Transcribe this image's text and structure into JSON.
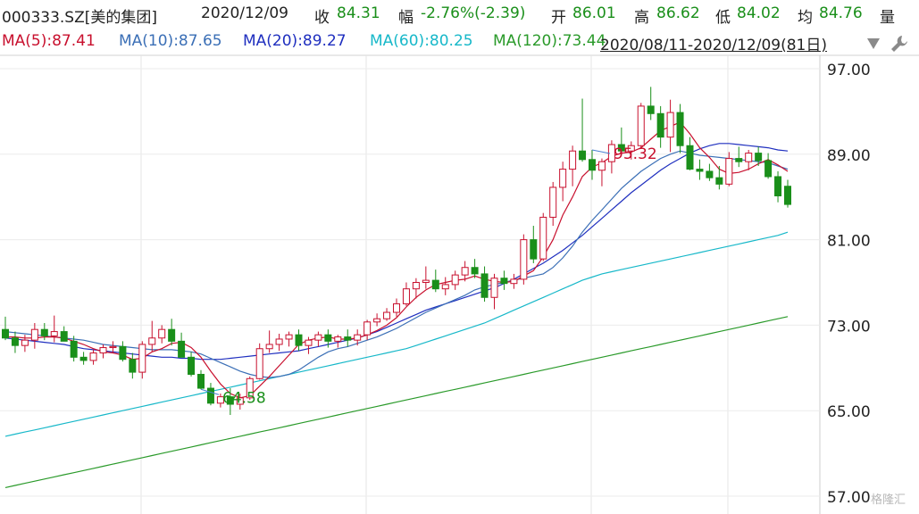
{
  "header": {
    "code": "000333.SZ[美的集团]",
    "date": "2020/12/09",
    "close_label": "收",
    "close_value": "84.31",
    "change_label": "幅",
    "change_value": "-2.76%(-2.39)",
    "open_label": "开",
    "open_value": "86.01",
    "high_label": "高",
    "high_value": "86.62",
    "low_label": "低",
    "low_value": "84.02",
    "avg_label": "均",
    "avg_value": "84.76",
    "volume_label": "量"
  },
  "ma_legend": [
    {
      "text": "MA(5):87.41",
      "color": "#c8102e"
    },
    {
      "text": "MA(10):87.65",
      "color": "#3b6fb6"
    },
    {
      "text": "MA(20):89.27",
      "color": "#1f2fbf"
    },
    {
      "text": "MA(60):80.25",
      "color": "#17b8c9"
    },
    {
      "text": "MA(120):73.44",
      "color": "#2a9a2a"
    }
  ],
  "range_text": "2020/08/11-2020/12/09(81日)",
  "watermark": "格隆汇",
  "chart_data": {
    "type": "candlestick",
    "ylim": [
      57,
      97
    ],
    "yticks": [
      "97.00",
      "89.00",
      "81.00",
      "73.00",
      "65.00",
      "57.00"
    ],
    "up_color": "#c8102e",
    "down_color": "#1a8f1a",
    "annotations": [
      {
        "text": "95.32",
        "color": "#c8102e",
        "index": 60
      },
      {
        "text": "64.58",
        "color": "#1a8f1a",
        "index": 20
      }
    ],
    "candles": [
      [
        72.6,
        73.8,
        71.6,
        71.8
      ],
      [
        71.8,
        72.4,
        70.4,
        71.1
      ],
      [
        71.1,
        72.1,
        70.5,
        71.6
      ],
      [
        71.6,
        73.2,
        70.8,
        72.6
      ],
      [
        72.6,
        73.2,
        71.6,
        72.0
      ],
      [
        72.0,
        73.9,
        71.4,
        72.4
      ],
      [
        72.4,
        72.9,
        71.7,
        71.5
      ],
      [
        71.5,
        72.0,
        69.6,
        70.0
      ],
      [
        70.0,
        70.5,
        69.3,
        69.7
      ],
      [
        69.7,
        70.7,
        69.3,
        70.4
      ],
      [
        70.4,
        71.2,
        69.9,
        70.9
      ],
      [
        70.9,
        71.5,
        70.4,
        71.0
      ],
      [
        71.0,
        71.5,
        69.6,
        69.8
      ],
      [
        69.8,
        70.4,
        68.0,
        68.6
      ],
      [
        68.6,
        71.5,
        68.0,
        71.2
      ],
      [
        71.2,
        73.4,
        70.5,
        71.8
      ],
      [
        71.8,
        73.0,
        71.3,
        72.6
      ],
      [
        72.6,
        73.6,
        71.1,
        71.5
      ],
      [
        71.5,
        72.3,
        70.3,
        70.0
      ],
      [
        70.0,
        70.5,
        68.2,
        68.4
      ],
      [
        68.4,
        68.8,
        67.0,
        67.1
      ],
      [
        67.1,
        67.6,
        65.5,
        65.7
      ],
      [
        65.7,
        66.6,
        65.3,
        66.3
      ],
      [
        66.3,
        67.1,
        64.6,
        65.6
      ],
      [
        65.6,
        66.6,
        65.1,
        66.2
      ],
      [
        66.2,
        68.2,
        66.0,
        68.0
      ],
      [
        68.0,
        71.3,
        67.9,
        70.8
      ],
      [
        70.8,
        72.5,
        70.4,
        71.2
      ],
      [
        71.2,
        72.2,
        70.6,
        71.7
      ],
      [
        71.7,
        72.4,
        71.0,
        72.1
      ],
      [
        72.1,
        72.6,
        70.6,
        71.1
      ],
      [
        71.1,
        71.9,
        70.3,
        71.6
      ],
      [
        71.6,
        72.4,
        71.0,
        72.1
      ],
      [
        72.1,
        72.6,
        70.9,
        71.5
      ],
      [
        71.5,
        72.1,
        70.9,
        71.9
      ],
      [
        71.9,
        72.6,
        71.0,
        71.6
      ],
      [
        71.6,
        72.6,
        71.1,
        72.1
      ],
      [
        72.1,
        73.5,
        71.6,
        73.3
      ],
      [
        73.3,
        74.1,
        72.9,
        73.6
      ],
      [
        73.6,
        74.6,
        73.4,
        74.2
      ],
      [
        74.2,
        75.5,
        73.8,
        75.0
      ],
      [
        75.0,
        77.0,
        74.8,
        76.4
      ],
      [
        76.4,
        77.4,
        75.5,
        77.0
      ],
      [
        77.0,
        78.5,
        76.4,
        77.2
      ],
      [
        77.2,
        78.2,
        76.1,
        76.4
      ],
      [
        76.4,
        77.5,
        75.8,
        76.8
      ],
      [
        76.8,
        78.1,
        76.3,
        77.7
      ],
      [
        77.7,
        79.0,
        77.1,
        78.4
      ],
      [
        78.4,
        79.2,
        77.4,
        77.8
      ],
      [
        77.8,
        78.5,
        75.2,
        75.6
      ],
      [
        75.6,
        77.8,
        74.5,
        77.4
      ],
      [
        77.4,
        78.1,
        76.3,
        76.9
      ],
      [
        76.9,
        77.8,
        76.4,
        77.3
      ],
      [
        77.3,
        81.5,
        76.8,
        81.0
      ],
      [
        81.0,
        82.3,
        78.8,
        79.2
      ],
      [
        79.2,
        83.5,
        79.0,
        83.1
      ],
      [
        83.1,
        86.4,
        82.3,
        85.9
      ],
      [
        85.9,
        88.3,
        84.6,
        87.6
      ],
      [
        87.6,
        89.8,
        86.0,
        89.3
      ],
      [
        89.3,
        94.2,
        88.3,
        88.5
      ],
      [
        88.5,
        89.4,
        86.6,
        87.5
      ],
      [
        87.5,
        88.6,
        86.0,
        88.3
      ],
      [
        88.3,
        90.3,
        87.2,
        89.9
      ],
      [
        89.9,
        91.5,
        89.0,
        89.3
      ],
      [
        89.3,
        90.2,
        88.5,
        89.8
      ],
      [
        89.8,
        93.8,
        89.5,
        93.5
      ],
      [
        93.5,
        95.3,
        92.2,
        92.8
      ],
      [
        92.8,
        93.5,
        89.6,
        90.6
      ],
      [
        90.6,
        94.1,
        89.2,
        92.9
      ],
      [
        92.9,
        93.7,
        89.1,
        89.8
      ],
      [
        89.8,
        90.6,
        87.5,
        87.6
      ],
      [
        87.6,
        88.5,
        86.6,
        87.4
      ],
      [
        87.4,
        88.1,
        86.5,
        86.8
      ],
      [
        86.8,
        87.9,
        85.7,
        86.2
      ],
      [
        86.2,
        89.2,
        86.0,
        88.6
      ],
      [
        88.6,
        89.7,
        87.8,
        88.3
      ],
      [
        88.3,
        89.4,
        87.5,
        89.1
      ],
      [
        89.1,
        89.7,
        87.9,
        88.4
      ],
      [
        88.4,
        89.1,
        86.7,
        86.9
      ],
      [
        86.9,
        87.4,
        84.5,
        85.1
      ],
      [
        86.0,
        86.6,
        84.0,
        84.3
      ]
    ],
    "ma5": [
      71.9,
      71.9,
      71.8,
      71.8,
      71.9,
      71.9,
      71.8,
      71.5,
      71.2,
      70.8,
      70.5,
      70.4,
      70.2,
      69.8,
      69.9,
      70.5,
      70.8,
      71.3,
      71.4,
      70.9,
      70.0,
      68.7,
      67.5,
      66.6,
      66.2,
      66.4,
      67.3,
      68.2,
      69.2,
      70.2,
      71.2,
      71.6,
      71.8,
      71.9,
      71.7,
      71.7,
      71.8,
      72.1,
      72.5,
      73.0,
      73.7,
      74.7,
      75.6,
      76.3,
      76.8,
      77.0,
      77.2,
      77.3,
      77.6,
      77.3,
      77.1,
      77.0,
      77.1,
      77.6,
      78.1,
      79.4,
      81.0,
      83.3,
      85.0,
      86.9,
      87.8,
      88.2,
      88.8,
      89.1,
      89.2,
      89.6,
      90.4,
      91.2,
      91.6,
      92.0,
      90.9,
      89.6,
      88.7,
      87.6,
      87.2,
      87.3,
      87.6,
      88.1,
      88.5,
      88.0,
      87.4
    ],
    "ma10": [
      72.4,
      72.3,
      72.2,
      72.1,
      72.0,
      71.9,
      71.8,
      71.7,
      71.6,
      71.4,
      71.2,
      71.1,
      71.0,
      70.9,
      70.8,
      70.7,
      70.7,
      70.7,
      70.6,
      70.5,
      70.3,
      69.9,
      69.5,
      69.1,
      68.7,
      68.4,
      68.2,
      68.1,
      68.2,
      68.4,
      68.8,
      69.4,
      70.0,
      70.5,
      70.8,
      71.0,
      71.3,
      71.6,
      71.9,
      72.3,
      72.7,
      73.2,
      73.7,
      74.2,
      74.6,
      75.0,
      75.4,
      75.8,
      76.3,
      76.6,
      76.8,
      77.0,
      77.2,
      77.4,
      77.6,
      77.8,
      78.4,
      79.3,
      80.4,
      81.7,
      82.8,
      83.8,
      84.8,
      85.8,
      86.6,
      87.4,
      88.0,
      88.6,
      89.0,
      89.3,
      89.1,
      88.9,
      88.8,
      88.7,
      88.6,
      88.5,
      88.4,
      88.3,
      88.2,
      87.9,
      87.6
    ],
    "ma20": [
      71.8,
      71.7,
      71.6,
      71.5,
      71.4,
      71.3,
      71.2,
      71.0,
      70.8,
      70.7,
      70.6,
      70.5,
      70.4,
      70.3,
      70.2,
      70.1,
      70.0,
      70.0,
      69.9,
      69.9,
      69.8,
      69.8,
      69.8,
      69.9,
      70.0,
      70.1,
      70.2,
      70.3,
      70.4,
      70.5,
      70.6,
      70.8,
      71.0,
      71.2,
      71.4,
      71.6,
      71.8,
      72.1,
      72.4,
      72.8,
      73.2,
      73.6,
      74.0,
      74.4,
      74.7,
      75.0,
      75.3,
      75.6,
      75.9,
      76.2,
      76.5,
      76.9,
      77.3,
      77.8,
      78.3,
      78.8,
      79.4,
      80.0,
      80.7,
      81.4,
      82.2,
      83.0,
      83.8,
      84.6,
      85.4,
      86.1,
      86.8,
      87.5,
      88.1,
      88.6,
      89.1,
      89.5,
      89.8,
      90.0,
      90.0,
      89.9,
      89.8,
      89.7,
      89.6,
      89.4,
      89.3
    ],
    "ma60": [
      62.6,
      62.8,
      63.0,
      63.2,
      63.4,
      63.6,
      63.8,
      64.0,
      64.2,
      64.4,
      64.6,
      64.8,
      65.0,
      65.2,
      65.4,
      65.6,
      65.8,
      66.0,
      66.2,
      66.4,
      66.6,
      66.8,
      67.0,
      67.2,
      67.4,
      67.6,
      67.8,
      68.0,
      68.2,
      68.4,
      68.6,
      68.8,
      69.0,
      69.2,
      69.4,
      69.6,
      69.8,
      70.0,
      70.2,
      70.4,
      70.6,
      70.8,
      71.1,
      71.4,
      71.7,
      72.0,
      72.3,
      72.6,
      72.9,
      73.2,
      73.6,
      74.0,
      74.4,
      74.8,
      75.2,
      75.6,
      76.0,
      76.4,
      76.8,
      77.2,
      77.5,
      77.8,
      78.0,
      78.2,
      78.4,
      78.6,
      78.8,
      79.0,
      79.2,
      79.4,
      79.6,
      79.8,
      80.0,
      80.2,
      80.4,
      80.6,
      80.8,
      81.0,
      81.2,
      81.4,
      81.7
    ],
    "ma120": [
      57.8,
      58.0,
      58.2,
      58.4,
      58.6,
      58.8,
      59.0,
      59.2,
      59.4,
      59.6,
      59.8,
      60.0,
      60.2,
      60.4,
      60.6,
      60.8,
      61.0,
      61.2,
      61.4,
      61.6,
      61.8,
      62.0,
      62.2,
      62.4,
      62.6,
      62.8,
      63.0,
      63.2,
      63.4,
      63.6,
      63.8,
      64.0,
      64.2,
      64.4,
      64.6,
      64.8,
      65.0,
      65.2,
      65.4,
      65.6,
      65.8,
      66.0,
      66.2,
      66.4,
      66.6,
      66.8,
      67.0,
      67.2,
      67.4,
      67.6,
      67.8,
      68.0,
      68.2,
      68.4,
      68.6,
      68.8,
      69.0,
      69.2,
      69.4,
      69.6,
      69.8,
      70.0,
      70.2,
      70.4,
      70.6,
      70.8,
      71.0,
      71.2,
      71.4,
      71.6,
      71.8,
      72.0,
      72.2,
      72.4,
      72.6,
      72.8,
      73.0,
      73.2,
      73.4,
      73.6,
      73.8
    ]
  }
}
